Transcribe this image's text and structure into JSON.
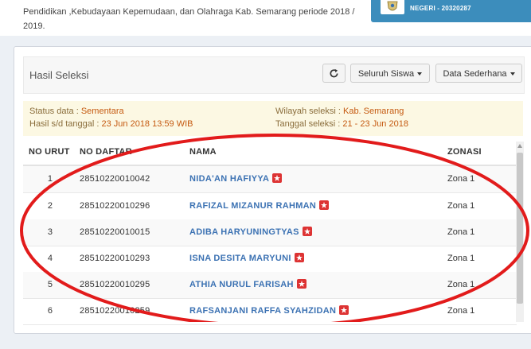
{
  "intro_text": "Pendidikan ,Kebudayaan Kepemudaan, dan Olahraga Kab. Semarang periode 2018 / 2019.",
  "school_badge": "NEGERI - 20320287",
  "panel": {
    "title": "Hasil Seleksi",
    "siswa_button": "Seluruh Siswa",
    "data_button": "Data Sederhana",
    "refresh_icon": "refresh-icon"
  },
  "info": {
    "status_label": "Status data :",
    "status_value": "Sementara",
    "hasil_label": "Hasil s/d tanggal :",
    "hasil_value": "23 Jun 2018 13:59 WIB",
    "wilayah_label": "Wilayah seleksi :",
    "wilayah_value": "Kab. Semarang",
    "tanggal_label": "Tanggal seleksi :",
    "tanggal_value": "21 - 23 Jun 2018"
  },
  "table": {
    "headers": [
      "NO URUT",
      "NO DAFTAR",
      "NAMA",
      "ZONASI"
    ],
    "rows": [
      {
        "no": "1",
        "daftar": "28510220010042",
        "nama": "NIDA'AN HAFIYYA",
        "zona": "Zona 1"
      },
      {
        "no": "2",
        "daftar": "28510220010296",
        "nama": "RAFIZAL MIZANUR RAHMAN",
        "zona": "Zona 1"
      },
      {
        "no": "3",
        "daftar": "28510220010015",
        "nama": "ADIBA HARYUNINGTYAS",
        "zona": "Zona 1"
      },
      {
        "no": "4",
        "daftar": "28510220010293",
        "nama": "ISNA DESITA MARYUNI",
        "zona": "Zona 1"
      },
      {
        "no": "5",
        "daftar": "28510220010295",
        "nama": "ATHIA NURUL FARISAH",
        "zona": "Zona 1"
      },
      {
        "no": "6",
        "daftar": "28510220010259",
        "nama": "RAFSANJANI RAFFA SYAHZIDAN",
        "zona": "Zona 1"
      }
    ]
  },
  "colors": {
    "accent": "#3c8dbc",
    "name_link": "#3c72b3",
    "warning_text": "#c55a11",
    "annotation_red": "#e21b1b"
  }
}
